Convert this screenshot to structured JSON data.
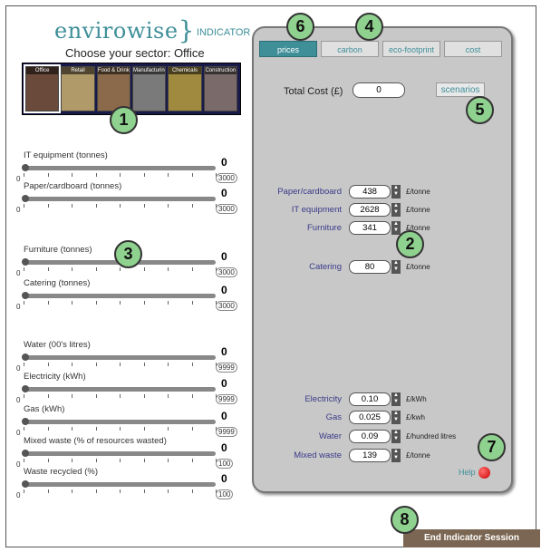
{
  "header": {
    "logo_text": "envirowise",
    "logo_suffix": "INDICATOR",
    "sector_prompt": "Choose your sector: Office"
  },
  "sectors": [
    {
      "label": "Office",
      "color": "#6a4a3a",
      "active": true
    },
    {
      "label": "Retail",
      "color": "#b09a6a",
      "active": false
    },
    {
      "label": "Food & Drink",
      "color": "#8a6a4a",
      "active": false
    },
    {
      "label": "Manufacturing",
      "color": "#7a7a7a",
      "active": false
    },
    {
      "label": "Chemicals",
      "color": "#a08a40",
      "active": false
    },
    {
      "label": "Construction",
      "color": "#7a6a6a",
      "active": false
    }
  ],
  "sliders": [
    {
      "label": "IT equipment (tonnes)",
      "value": "0",
      "min": "0",
      "max": "3000",
      "level": 0
    },
    {
      "label": "Paper/cardboard (tonnes)",
      "value": "0",
      "min": "0",
      "max": "3000",
      "level": 0
    },
    {
      "label": "Furniture (tonnes)",
      "value": "0",
      "min": "0",
      "max": "3000",
      "level": 0
    },
    {
      "label": "Catering (tonnes)",
      "value": "0",
      "min": "0",
      "max": "3000",
      "level": 0
    },
    {
      "label": "Water (00's litres)",
      "value": "0",
      "min": "0",
      "max": "9999",
      "level": 0
    },
    {
      "label": "Electricity (kWh)",
      "value": "0",
      "min": "0",
      "max": "9999",
      "level": 0
    },
    {
      "label": "Gas (kWh)",
      "value": "0",
      "min": "0",
      "max": "9999",
      "level": 0
    },
    {
      "label": "Mixed waste (% of resources wasted)",
      "value": "0",
      "min": "0",
      "max": "100",
      "level": 0
    },
    {
      "label": "Waste recycled (%)",
      "value": "0",
      "min": "0",
      "max": "100",
      "level": 0
    }
  ],
  "tabs": [
    {
      "label": "prices",
      "active": true
    },
    {
      "label": "carbon",
      "active": false
    },
    {
      "label": "eco-footprint",
      "active": false
    },
    {
      "label": "cost",
      "active": false
    }
  ],
  "total_cost": {
    "label": "Total Cost (£)",
    "value": "0"
  },
  "scenarios_label": "scenarios",
  "prices": [
    {
      "label": "Paper/cardboard",
      "value": "438",
      "unit": "£/tonne"
    },
    {
      "label": "IT equipment",
      "value": "2628",
      "unit": "£/tonne"
    },
    {
      "label": "Furniture",
      "value": "341",
      "unit": "£/tonne"
    },
    {
      "label": "Catering",
      "value": "80",
      "unit": "£/tonne"
    },
    {
      "label": "Electricity",
      "value": "0.10",
      "unit": "£/kWh"
    },
    {
      "label": "Gas",
      "value": "0.025",
      "unit": "£/kwh"
    },
    {
      "label": "Water",
      "value": "0.09",
      "unit": "£/hundred litres"
    },
    {
      "label": "Mixed waste",
      "value": "139",
      "unit": "£/tonne"
    }
  ],
  "help_label": "Help",
  "end_session_label": "End Indicator Session",
  "badges": [
    "1",
    "2",
    "3",
    "4",
    "5",
    "6",
    "7",
    "8"
  ],
  "colors": {
    "accent": "#3f8f99",
    "badge": "#8fd18f",
    "end_button": "#7a6652",
    "help_dot": "#cc0000"
  }
}
